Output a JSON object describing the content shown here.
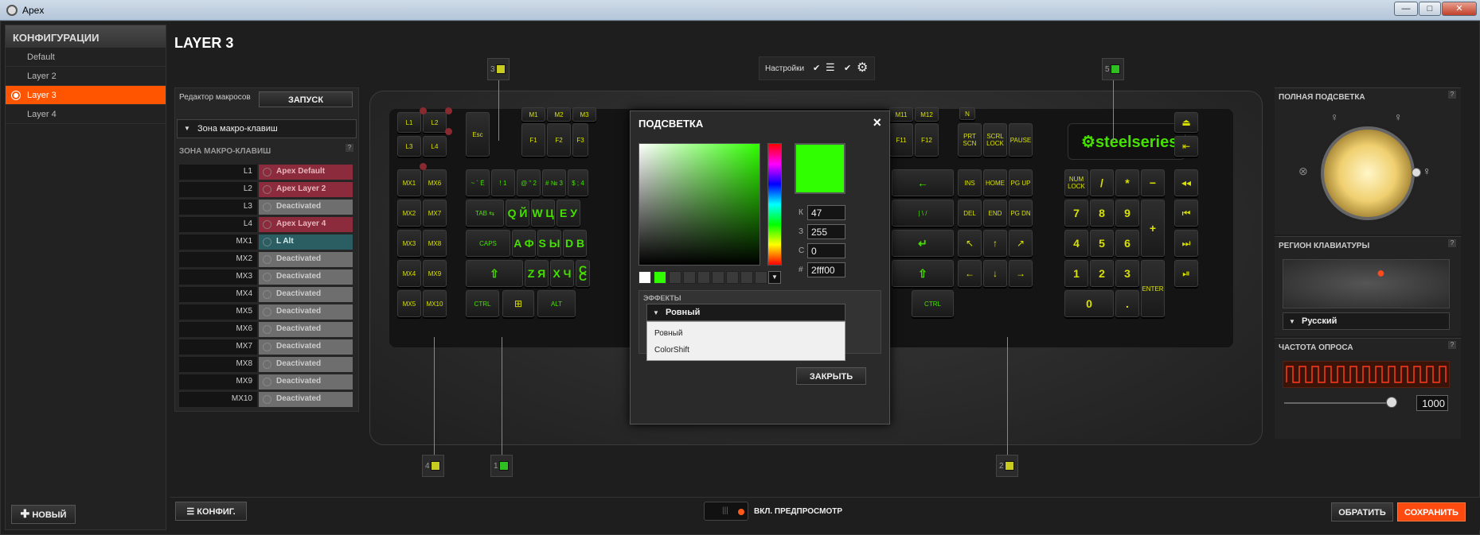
{
  "window": {
    "title": "Apex",
    "min": "—",
    "max": "□",
    "close": "✕"
  },
  "sidebar": {
    "title": "КОНФИГУРАЦИИ",
    "items": [
      {
        "label": "Default"
      },
      {
        "label": "Layer 2"
      },
      {
        "label": "Layer 3"
      },
      {
        "label": "Layer 4"
      }
    ],
    "new_button": "НОВЫЙ",
    "new_icon": "plus-icon"
  },
  "page": {
    "title": "LAYER 3"
  },
  "macro": {
    "editor_label": "Редактор макросов",
    "launch_button": "ЗАПУСК",
    "zone_dropdown": "Зона макро-клавиш",
    "zone_title": "ЗОНА МАКРО-КЛАВИШ",
    "help": "?",
    "rows": [
      {
        "key": "L1",
        "value": "Apex Default",
        "style": "red"
      },
      {
        "key": "L2",
        "value": "Apex Layer 2",
        "style": "red"
      },
      {
        "key": "L3",
        "value": "Deactivated",
        "style": "def"
      },
      {
        "key": "L4",
        "value": "Apex Layer 4",
        "style": "red"
      },
      {
        "key": "MX1",
        "value": "L Alt",
        "style": "teal"
      },
      {
        "key": "MX2",
        "value": "Deactivated",
        "style": "def"
      },
      {
        "key": "MX3",
        "value": "Deactivated",
        "style": "def"
      },
      {
        "key": "MX4",
        "value": "Deactivated",
        "style": "def"
      },
      {
        "key": "MX5",
        "value": "Deactivated",
        "style": "def"
      },
      {
        "key": "MX6",
        "value": "Deactivated",
        "style": "def"
      },
      {
        "key": "MX7",
        "value": "Deactivated",
        "style": "def"
      },
      {
        "key": "MX8",
        "value": "Deactivated",
        "style": "def"
      },
      {
        "key": "MX9",
        "value": "Deactivated",
        "style": "def"
      },
      {
        "key": "MX10",
        "value": "Deactivated",
        "style": "def"
      }
    ]
  },
  "settings_bar": {
    "label": "Настройки"
  },
  "zones": [
    {
      "num": "3",
      "color": "#c8cc20"
    },
    {
      "num": "5",
      "color": "#2fbf20"
    },
    {
      "num": "4",
      "color": "#c8cc20"
    },
    {
      "num": "1",
      "color": "#2fbf20"
    },
    {
      "num": "2",
      "color": "#c8cc20"
    }
  ],
  "keyboard": {
    "brand": "steelseries",
    "keys": {
      "l1": "L1",
      "l2": "L2",
      "l3": "L3",
      "l4": "L4",
      "esc": "Esc",
      "m1": "M1",
      "m2": "M2",
      "m3": "M3",
      "m11": "M11",
      "m12": "M12",
      "f1": "F1",
      "f2": "F2",
      "f3": "F3",
      "f11": "F11",
      "f12": "F12",
      "n": "N",
      "prtscn": "PRT SCN",
      "scrllock": "SCRL LOCK",
      "pause": "PAUSE",
      "mx1": "MX1",
      "mx2": "MX2",
      "mx3": "MX3",
      "mx4": "MX4",
      "mx5": "MX5",
      "mx6": "MX6",
      "mx7": "MX7",
      "mx8": "MX8",
      "mx9": "MX9",
      "mx10": "MX10",
      "tilde": "~ ` Ё",
      "k1": "! 1",
      "k2": "@ \" 2",
      "k3": "# № 3",
      "k4": "$ ; 4",
      "tab": "TAB ⇆",
      "q": "Q Й",
      "w": "W Ц",
      "e": "E У",
      "caps": "CAPS",
      "a": "A Ф",
      "s": "S Ы",
      "d": "D В",
      "shift": "⇧",
      "z": "Z Я",
      "x": "X Ч",
      "c": "C С",
      "ctrl": "CTRL",
      "alt": "ALT",
      "rctrl": "CTRL",
      "backspace": "←",
      "backslash": "| \\ /",
      "enter": "↵",
      "rshift": "⇧",
      "ins": "INS",
      "home": "HOME",
      "pgup": "PG UP",
      "del": "DEL",
      "end": "END",
      "pgdn": "PG DN",
      "numlock": "NUM LOCK",
      "slash": "/",
      "star": "*",
      "minus": "−",
      "n7": "7",
      "n8": "8",
      "n9": "9",
      "plus": "+",
      "n4": "4",
      "n5": "5",
      "n6": "6",
      "n1": "1",
      "n2": "2",
      "n3": "3",
      "nenter": "ENTER",
      "n0": "0",
      "ndot": "."
    }
  },
  "dialog": {
    "title": "ПОДСВЕТКА",
    "close": "×",
    "preview_color": "#2fff00",
    "k_label": "К",
    "k_value": "47",
    "z_label": "З",
    "z_value": "255",
    "s_label": "С",
    "s_value": "0",
    "hex_label": "#",
    "hex_value": "2fff00",
    "effects_title": "ЭФФЕКТЫ",
    "effect_selected": "Ровный",
    "effect_options": [
      "Ровный",
      "ColorShift"
    ],
    "close_button": "ЗАКРЫТЬ"
  },
  "right": {
    "illumination_title": "ПОЛНАЯ ПОДСВЕТКА",
    "region_title": "РЕГИОН КЛАВИАТУРЫ",
    "region_value": "Русский",
    "polling_title": "ЧАСТОТА ОПРОСА",
    "polling_value": "1000",
    "help": "?"
  },
  "bottom": {
    "config_button": "КОНФИГ.",
    "preview_label": "ВКЛ. ПРЕДПРОСМОТР",
    "revert_button": "ОБРАТИТЬ",
    "save_button": "СОХРАНИТЬ"
  }
}
